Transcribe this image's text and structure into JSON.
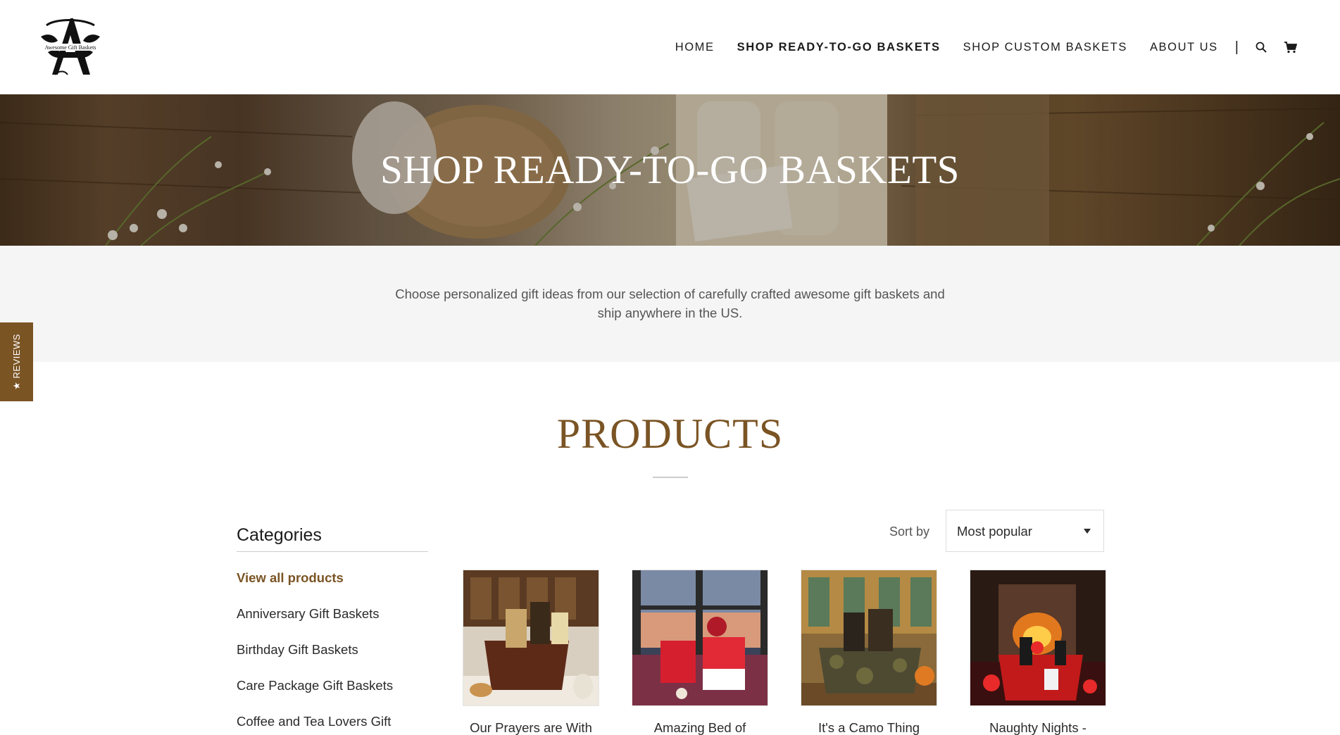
{
  "brand": {
    "logo_text": "Awesome Gift Baskets",
    "logo_letter": "A"
  },
  "nav": {
    "items": [
      {
        "label": "HOME",
        "active": false
      },
      {
        "label": "SHOP READY-TO-GO BASKETS",
        "active": true
      },
      {
        "label": "SHOP CUSTOM BASKETS",
        "active": false
      },
      {
        "label": "ABOUT US",
        "active": false
      }
    ],
    "separator": "|",
    "search_icon": "search-icon",
    "cart_icon": "cart-icon"
  },
  "hero": {
    "title": "SHOP READY-TO-GO BASKETS"
  },
  "intro": {
    "text": "Choose personalized gift ideas from our selection of carefully crafted awesome gift baskets and ship anywhere in the US."
  },
  "reviews_tab": {
    "label": "★ REVIEWS"
  },
  "products_section": {
    "title": "PRODUCTS"
  },
  "sidebar": {
    "title": "Categories",
    "items": [
      {
        "label": "View all products"
      },
      {
        "label": "Anniversary Gift Baskets"
      },
      {
        "label": "Birthday Gift Baskets"
      },
      {
        "label": "Care Package Gift Baskets"
      },
      {
        "label": "Coffee and Tea Lovers Gift"
      }
    ]
  },
  "sort": {
    "label": "Sort by",
    "value": "Most popular"
  },
  "products": [
    {
      "name": "Our Prayers are With"
    },
    {
      "name": "Amazing Bed of"
    },
    {
      "name": "It's a Camo Thing"
    },
    {
      "name": "Naughty Nights -"
    }
  ],
  "colors": {
    "accent": "#7a5424",
    "reviews_tab": "#7b5424",
    "intro_band": "#f5f5f5"
  }
}
